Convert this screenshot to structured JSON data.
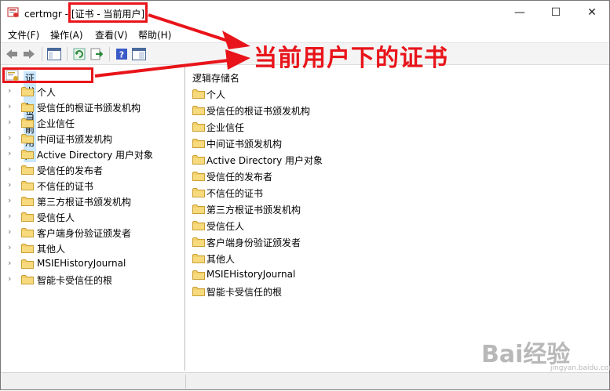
{
  "window": {
    "title_prefix": "certmgr - ",
    "title_highlight": "[证书 - 当前用户]",
    "controls": {
      "minimize": "—",
      "maximize": "☐",
      "close": "✕"
    }
  },
  "menu": [
    "文件(F)",
    "操作(A)",
    "查看(V)",
    "帮助(H)"
  ],
  "toolbar": {
    "icons": [
      "back-arrow-icon",
      "forward-arrow-icon",
      "show-hide-tree-icon",
      "refresh-icon",
      "export-list-icon",
      "help-icon",
      "properties-icon"
    ]
  },
  "tree": {
    "root": "证书 - 当前用户",
    "items": [
      "个人",
      "受信任的根证书颁发机构",
      "企业信任",
      "中间证书颁发机构",
      "Active Directory 用户对象",
      "受信任的发布者",
      "不信任的证书",
      "第三方根证书颁发机构",
      "受信任人",
      "客户端身份验证颁发者",
      "其他人",
      "MSIEHistoryJournal",
      "智能卡受信任的根"
    ]
  },
  "list": {
    "header": "逻辑存储名",
    "items": [
      "个人",
      "受信任的根证书颁发机构",
      "企业信任",
      "中间证书颁发机构",
      "Active Directory 用户对象",
      "受信任的发布者",
      "不信任的证书",
      "第三方根证书颁发机构",
      "受信任人",
      "客户端身份验证颁发者",
      "其他人",
      "MSIEHistoryJournal",
      "智能卡受信任的根"
    ]
  },
  "annotation": {
    "text": "当前用户下的证书",
    "color": "#e8141a"
  },
  "watermark": {
    "text": "Bai经验",
    "sub": "jingyan.baidu.com"
  }
}
